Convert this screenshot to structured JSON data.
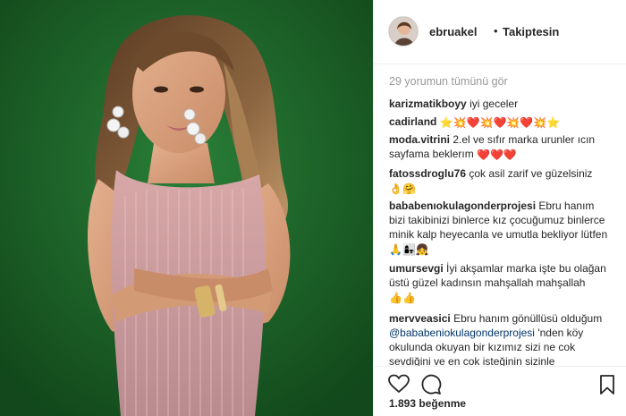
{
  "post": {
    "username": "ebruakel",
    "separator": "•",
    "follow_status": "Takiptesin",
    "view_all_comments": "29 yorumun tümünü gör",
    "likes": "1.893 beğenme"
  },
  "comments": [
    {
      "user": "karizmatikboyy",
      "text": "iyi geceler",
      "emoji": ""
    },
    {
      "user": "cadirland",
      "text": "",
      "emoji": "⭐💥❤️💥❤️💥❤️💥⭐"
    },
    {
      "user": "moda.vitrini",
      "text": "2.el ve sıfır marka urunler ıcın sayfama beklerım",
      "emoji": "❤️❤️❤️"
    },
    {
      "user": "fatossdroglu76",
      "text": "çok asil zarif ve güzelsiniz",
      "emoji": "👌🤗"
    },
    {
      "user": "bababenıokulagonderprojesi",
      "text": "Ebru hanım bizi takibinizi binlerce kız çocuğumuz binlerce minik kalp heyecanla ve umutla bekliyor lütfen",
      "emoji": "🙏👩‍👧👧"
    },
    {
      "user": "umursevgi",
      "text": "İyi akşamlar marka işte bu olağan üstü güzel kadınsın mahşallah mahşallah",
      "emoji": "👍👍"
    },
    {
      "user": "mervveasici",
      "text": "Ebru hanım gönüllüsü olduğum",
      "mention": "@bababeniokulagonderprojesi",
      "text_after": "'nden köy okulunda okuyan bir kızımız sizi ne cok sevdiğini ve en cok isteğinin sizinle"
    }
  ],
  "icons": {
    "like": "heart-outline-icon",
    "comment": "speech-bubble-icon",
    "save": "bookmark-icon"
  },
  "colors": {
    "photo_background": "#1f6a2c",
    "username_text": "#262626",
    "muted_text": "#999999",
    "mention_link": "#003569"
  }
}
